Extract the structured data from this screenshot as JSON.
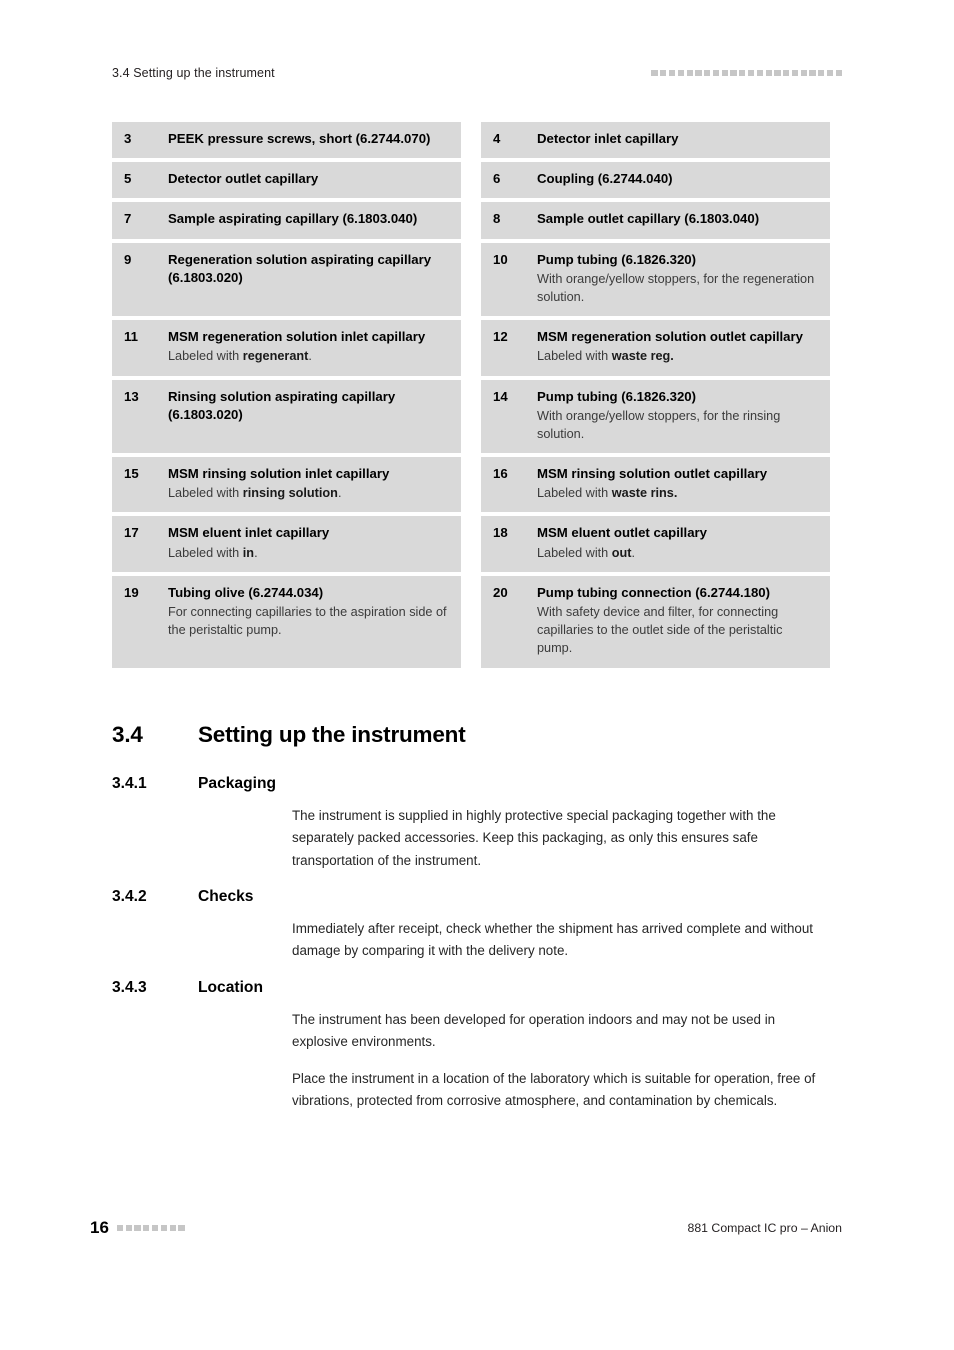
{
  "header": {
    "running_title": "3.4 Setting up the instrument",
    "decoration_squares": 22,
    "decoration_color": "#c6c6c6"
  },
  "parts_table": {
    "rows": [
      {
        "left": {
          "number": "3",
          "title": "PEEK pressure screws, short (6.2744.070)",
          "desc": ""
        },
        "right": {
          "number": "4",
          "title": "Detector inlet capillary",
          "desc": ""
        }
      },
      {
        "left": {
          "number": "5",
          "title": "Detector outlet capillary",
          "desc": ""
        },
        "right": {
          "number": "6",
          "title": "Coupling (6.2744.040)",
          "desc": ""
        }
      },
      {
        "left": {
          "number": "7",
          "title": "Sample aspirating capillary (6.1803.040)",
          "desc": ""
        },
        "right": {
          "number": "8",
          "title": "Sample outlet capillary (6.1803.040)",
          "desc": ""
        }
      },
      {
        "left": {
          "number": "9",
          "title": "Regeneration solution aspirating capillary (6.1803.020)",
          "desc": ""
        },
        "right": {
          "number": "10",
          "title": "Pump tubing (6.1826.320)",
          "desc": "With orange/yellow stoppers, for the regeneration solution."
        }
      },
      {
        "left": {
          "number": "11",
          "title": "MSM regeneration solution inlet capillary",
          "desc_html": "Labeled with <b>regenerant</b>."
        },
        "right": {
          "number": "12",
          "title": "MSM regeneration solution outlet capillary",
          "desc_html": "Labeled with <b>waste reg.</b>"
        }
      },
      {
        "left": {
          "number": "13",
          "title": "Rinsing solution aspirating capillary (6.1803.020)",
          "desc": ""
        },
        "right": {
          "number": "14",
          "title": "Pump tubing (6.1826.320)",
          "desc": "With orange/yellow stoppers, for the rinsing solution."
        }
      },
      {
        "left": {
          "number": "15",
          "title": "MSM rinsing solution inlet capillary",
          "desc_html": "Labeled with <b>rinsing solution</b>."
        },
        "right": {
          "number": "16",
          "title": "MSM rinsing solution outlet capillary",
          "desc_html": "Labeled with <b>waste rins.</b>"
        }
      },
      {
        "left": {
          "number": "17",
          "title": "MSM eluent inlet capillary",
          "desc_html": "Labeled with <b>in</b>."
        },
        "right": {
          "number": "18",
          "title": "MSM eluent outlet capillary",
          "desc_html": "Labeled with <b>out</b>."
        }
      },
      {
        "left": {
          "number": "19",
          "title": "Tubing olive (6.2744.034)",
          "desc": "For connecting capillaries to the aspiration side of the peristaltic pump."
        },
        "right": {
          "number": "20",
          "title": "Pump tubing connection (6.2744.180)",
          "desc": "With safety device and filter, for connecting capillaries to the outlet side of the peristaltic pump."
        }
      }
    ]
  },
  "sections": {
    "main": {
      "number": "3.4",
      "title": "Setting up the instrument"
    },
    "packaging": {
      "number": "3.4.1",
      "title": "Packaging",
      "paragraph_1": "The instrument is supplied in highly protective special packaging together with the separately packed accessories. Keep this packaging, as only this ensures safe transportation of the instrument."
    },
    "checks": {
      "number": "3.4.2",
      "title": "Checks",
      "paragraph_1": "Immediately after receipt, check whether the shipment has arrived complete and without damage by comparing it with the delivery note."
    },
    "location": {
      "number": "3.4.3",
      "title": "Location",
      "paragraph_1": "The instrument has been developed for operation indoors and may not be used in explosive environments.",
      "paragraph_2": "Place the instrument in a location of the laboratory which is suitable for operation, free of vibrations, protected from corrosive atmosphere, and contamination by chemicals."
    }
  },
  "footer": {
    "page_number": "16",
    "decoration_squares": 8,
    "document_title": "881 Compact IC pro – Anion"
  }
}
